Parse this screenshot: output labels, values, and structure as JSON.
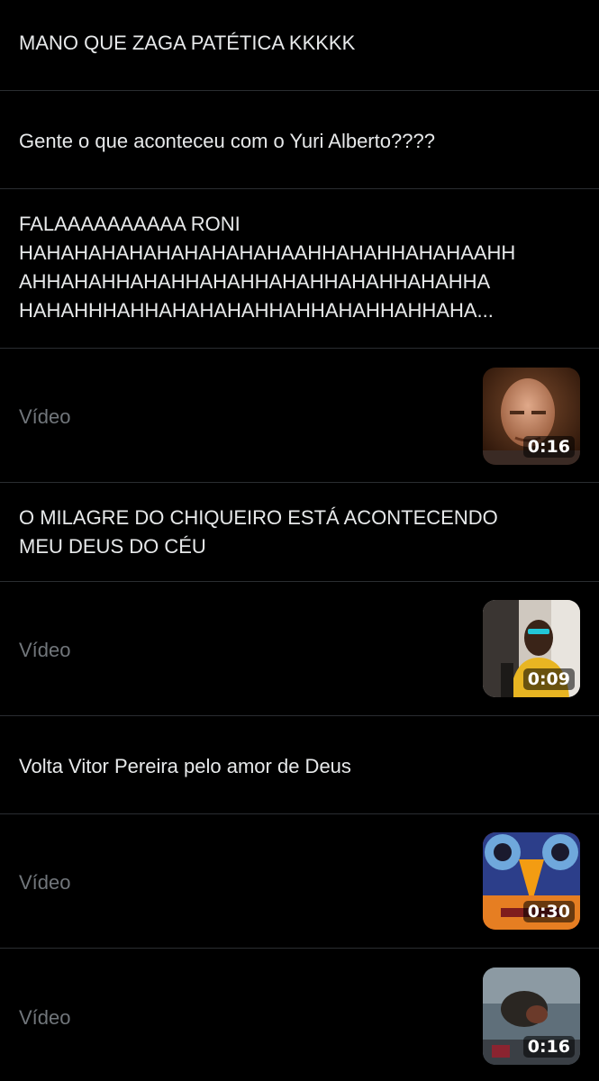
{
  "feed": {
    "items": [
      {
        "type": "text",
        "text": "MANO QUE ZAGA PATÉTICA KKKKK"
      },
      {
        "type": "text",
        "text": "Gente o que aconteceu com o Yuri Alberto????"
      },
      {
        "type": "text",
        "lines": [
          "FALAAAAAAAAAA RONI",
          "HAHAHAHAHAHAHAHAHAHAAHHAHAHHAHAHAAHH",
          "AHHAHAHHAHAHHAHAHHAHAHHAHAHHAHAHHA",
          "HAHAHHHAHHAHAHAHAHHAHHAHAHHAHHAHA..."
        ]
      },
      {
        "type": "video",
        "label": "Vídeo",
        "duration": "0:16",
        "thumb_icon": "bald-man-portrait"
      },
      {
        "type": "text",
        "lines": [
          "O MILAGRE DO CHIQUEIRO ESTÁ ACONTECENDO",
          "MEU DEUS DO CÉU"
        ]
      },
      {
        "type": "video",
        "label": "Vídeo",
        "duration": "0:09",
        "thumb_icon": "person-yellow-shirt"
      },
      {
        "type": "text",
        "text": "Volta Vitor Pereira pelo amor de Deus"
      },
      {
        "type": "video",
        "label": "Vídeo",
        "duration": "0:30",
        "thumb_icon": "colorful-mosaic-face"
      },
      {
        "type": "video",
        "label": "Vídeo",
        "duration": "0:16",
        "thumb_icon": "blurry-dark-frame"
      }
    ]
  },
  "colors": {
    "background": "#000000",
    "text": "#e7e9ea",
    "muted": "#71767b",
    "divider": "#2a2d31"
  }
}
